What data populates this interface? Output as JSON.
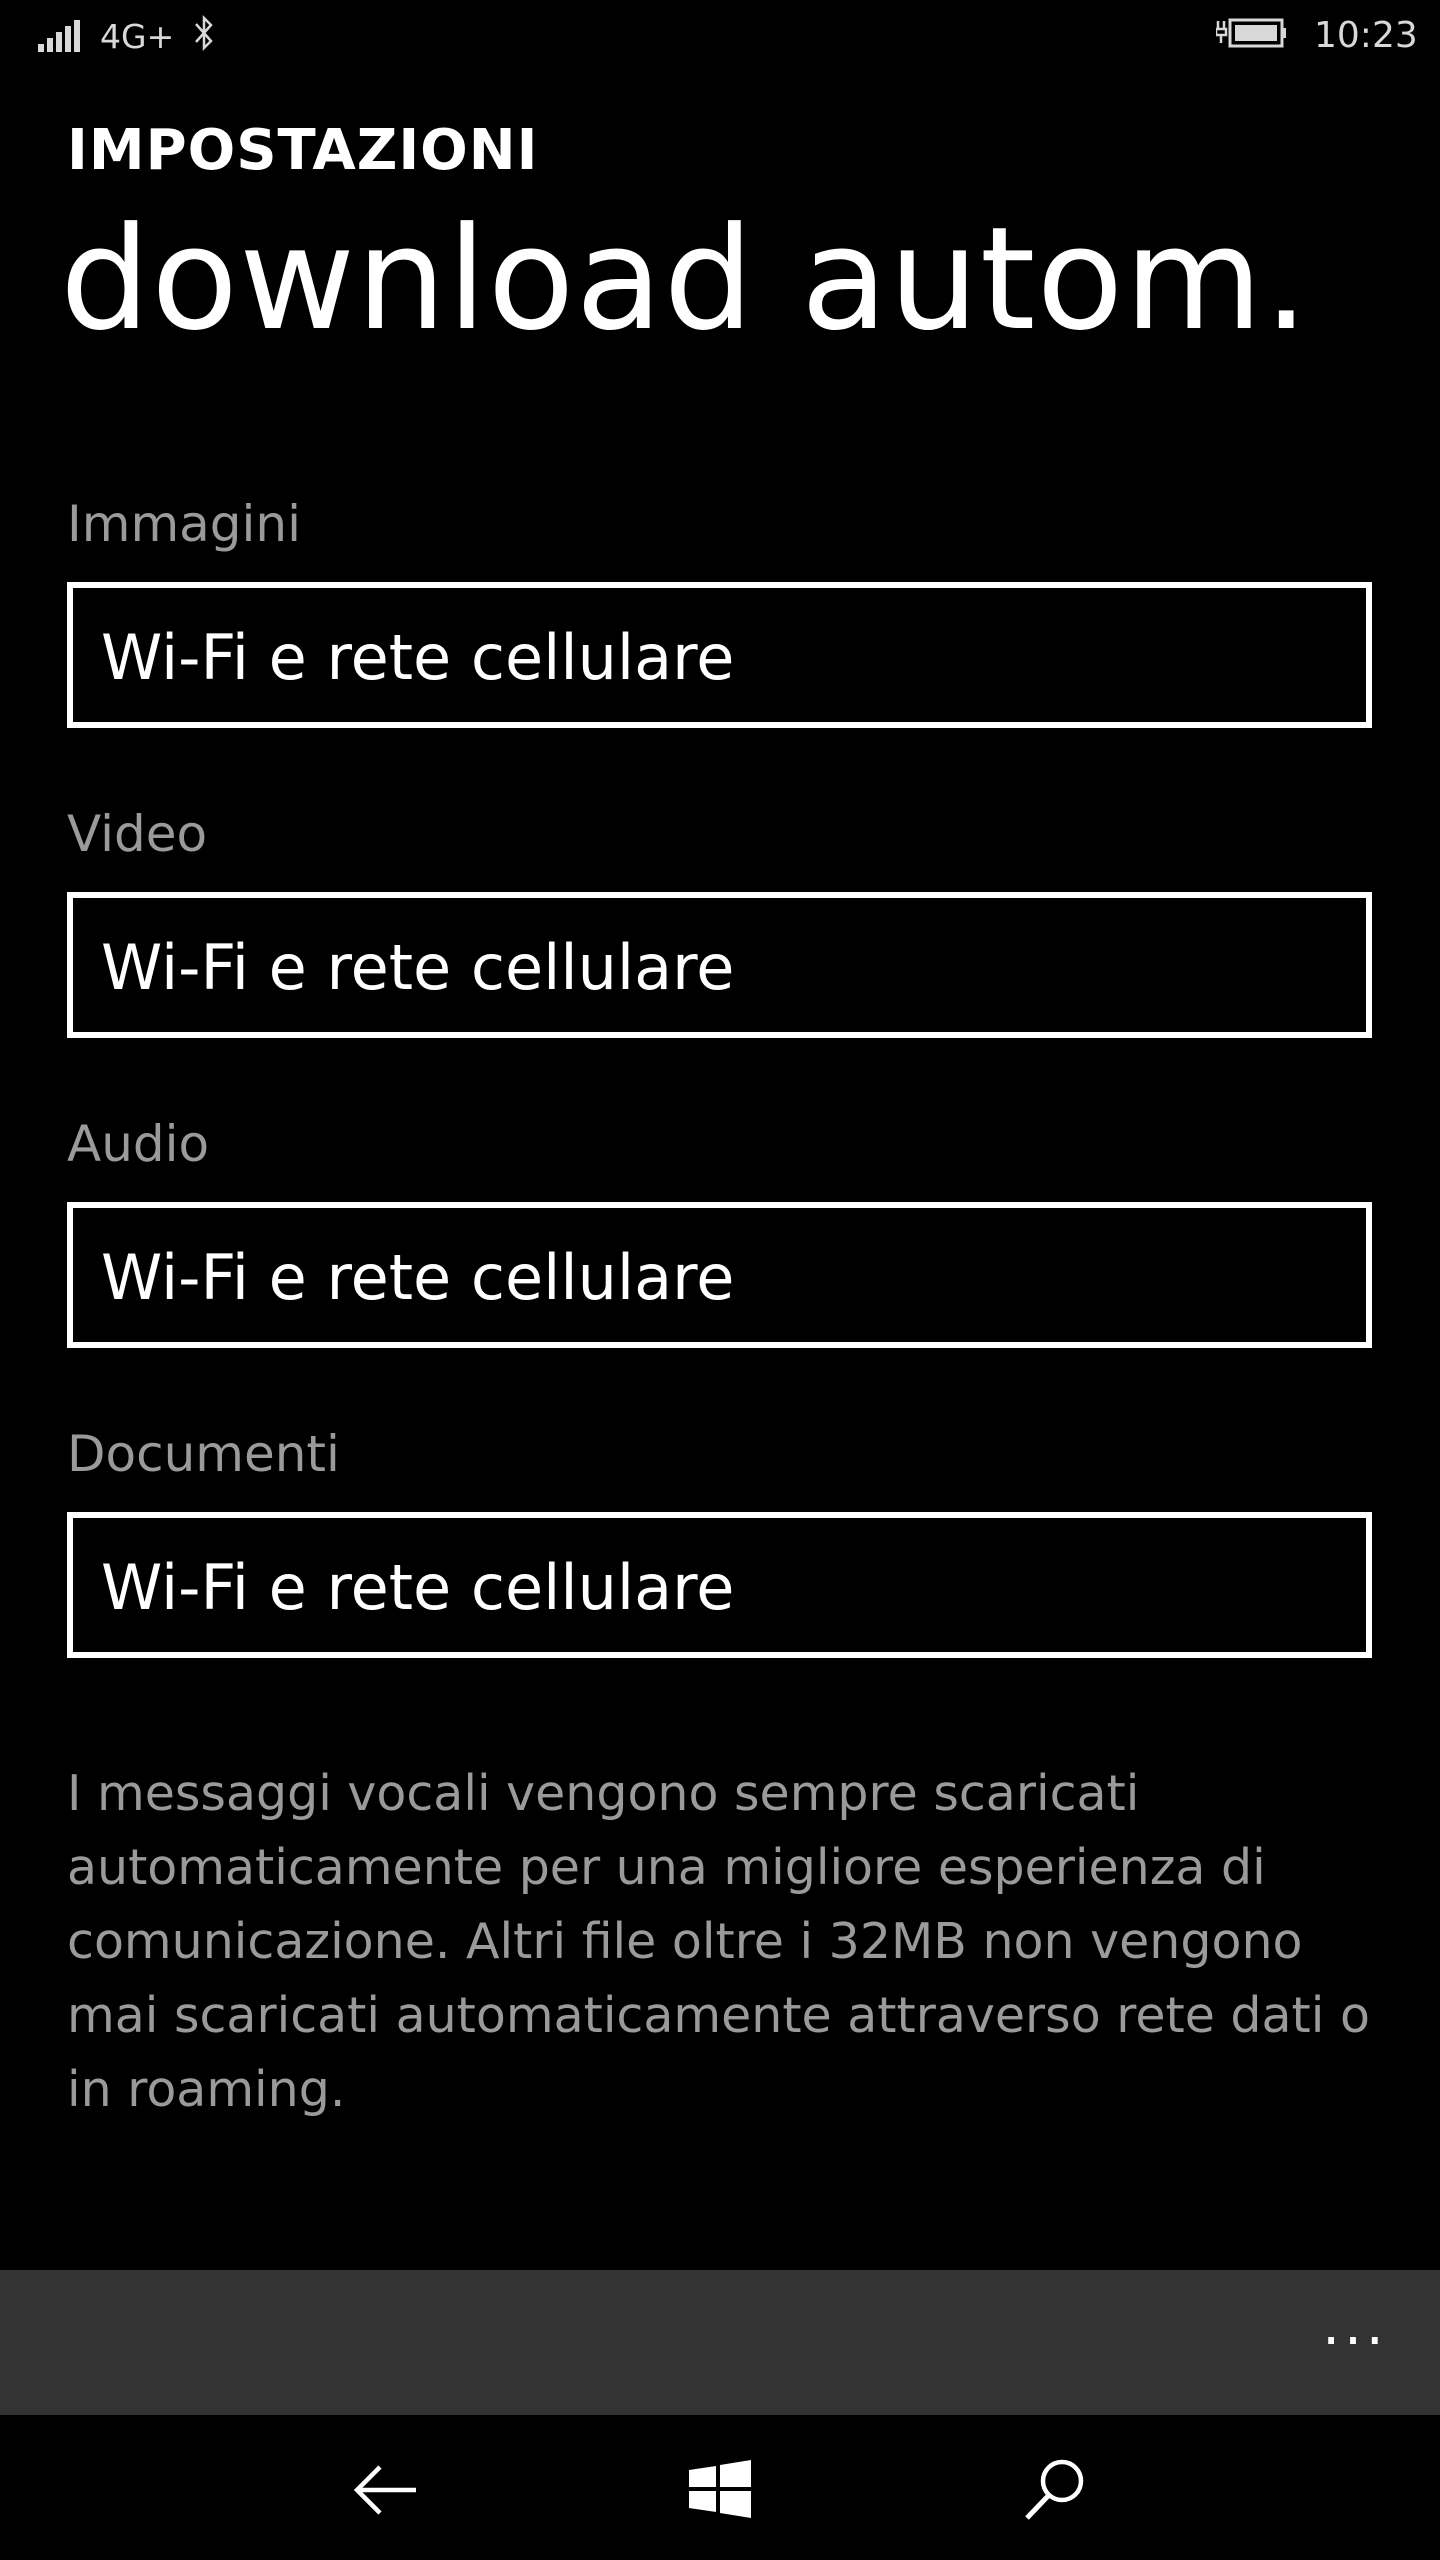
{
  "status_bar": {
    "network": "4G+",
    "time": "10:23",
    "icons": [
      "signal-strength-icon",
      "bluetooth-icon",
      "battery-charging-icon"
    ]
  },
  "header": {
    "app_title": "IMPOSTAZIONI",
    "page_title": "download autom."
  },
  "settings": [
    {
      "label": "Immagini",
      "value": "Wi-Fi e rete cellulare"
    },
    {
      "label": "Video",
      "value": "Wi-Fi e rete cellulare"
    },
    {
      "label": "Audio",
      "value": "Wi-Fi e rete cellulare"
    },
    {
      "label": "Documenti",
      "value": "Wi-Fi e rete cellulare"
    }
  ],
  "info_text": "I messaggi vocali vengono sempre scaricati automaticamente per una migliore esperienza di comunicazione. Altri file oltre i 32MB non vengono mai scaricati automaticamente attraverso rete dati o in roaming.",
  "app_bar": {
    "more_label": "..."
  },
  "nav_bar": {
    "icons": [
      "back-arrow-icon",
      "windows-logo-icon",
      "search-icon"
    ]
  },
  "colors": {
    "background": "#000000",
    "foreground": "#ffffff",
    "secondary_text": "#9a9a9a",
    "app_bar": "#333333"
  }
}
